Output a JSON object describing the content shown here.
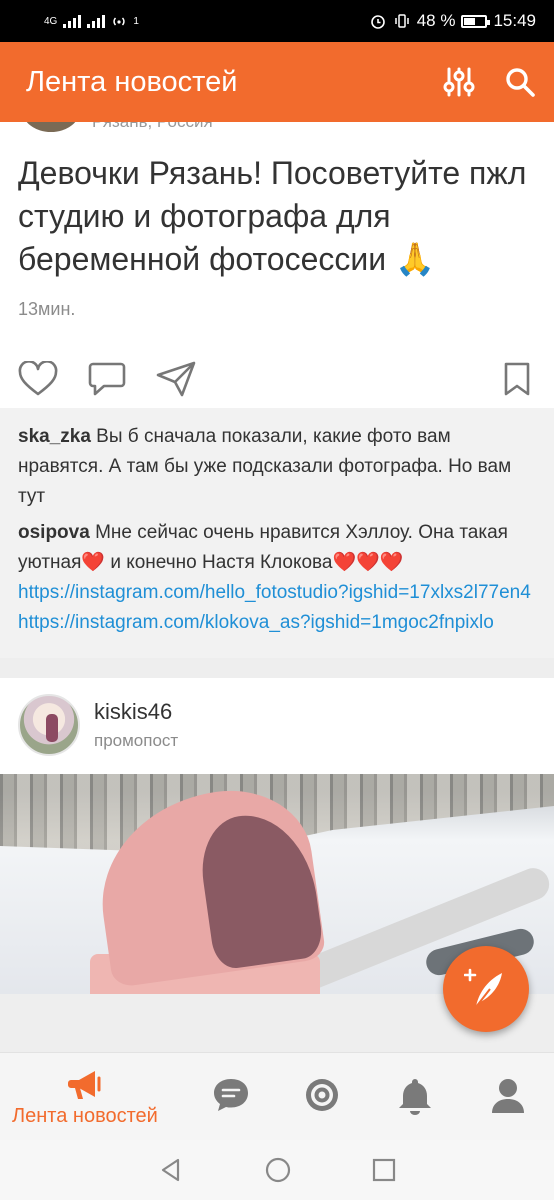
{
  "status_bar": {
    "network_label": "4G",
    "notification_count": "1",
    "battery_percent": "48 %",
    "time": "15:49"
  },
  "app_bar": {
    "title": "Лента новостей",
    "filter_icon": "filter-sliders-icon",
    "search_icon": "search-icon"
  },
  "post1": {
    "author_location": "Рязань, Россия",
    "text": "Девочки Рязань! Посоветуйте пжл студию и фотографа для беременной фотосессии 🙏",
    "time": "13мин.",
    "actions": [
      "heart-icon",
      "comment-icon",
      "share-icon",
      "bookmark-icon"
    ]
  },
  "comments": [
    {
      "author": "ska_zka",
      "text": " Вы б сначала показали, какие фото вам нравятся. А там бы уже подсказали фотографа. Но вам тут"
    },
    {
      "author": "osipova",
      "text": " Мне сейчас очень нравится Хэллоу. Она такая уютная❤️ и конечно Настя Клокова❤️❤️❤️",
      "links": [
        "https://instagram.com/hello_fotostudio?igshid=17xlxs2l77en4",
        "https://instagram.com/klokova_as?igshid=1mgoc2fnpixlo"
      ]
    }
  ],
  "post2": {
    "author_name": "kiskis46",
    "subtitle": "промопост"
  },
  "fab": {
    "icon": "compose-feather-icon"
  },
  "bottom_nav": {
    "active_label": "Лента новостей",
    "items": [
      "feed-megaphone-icon",
      "messages-icon",
      "discussions-target-icon",
      "notifications-bell-icon",
      "profile-icon"
    ]
  },
  "system_nav": [
    "back-icon",
    "home-icon",
    "recents-icon"
  ],
  "colors": {
    "accent": "#f26b2d",
    "link": "#1f8fd6"
  }
}
